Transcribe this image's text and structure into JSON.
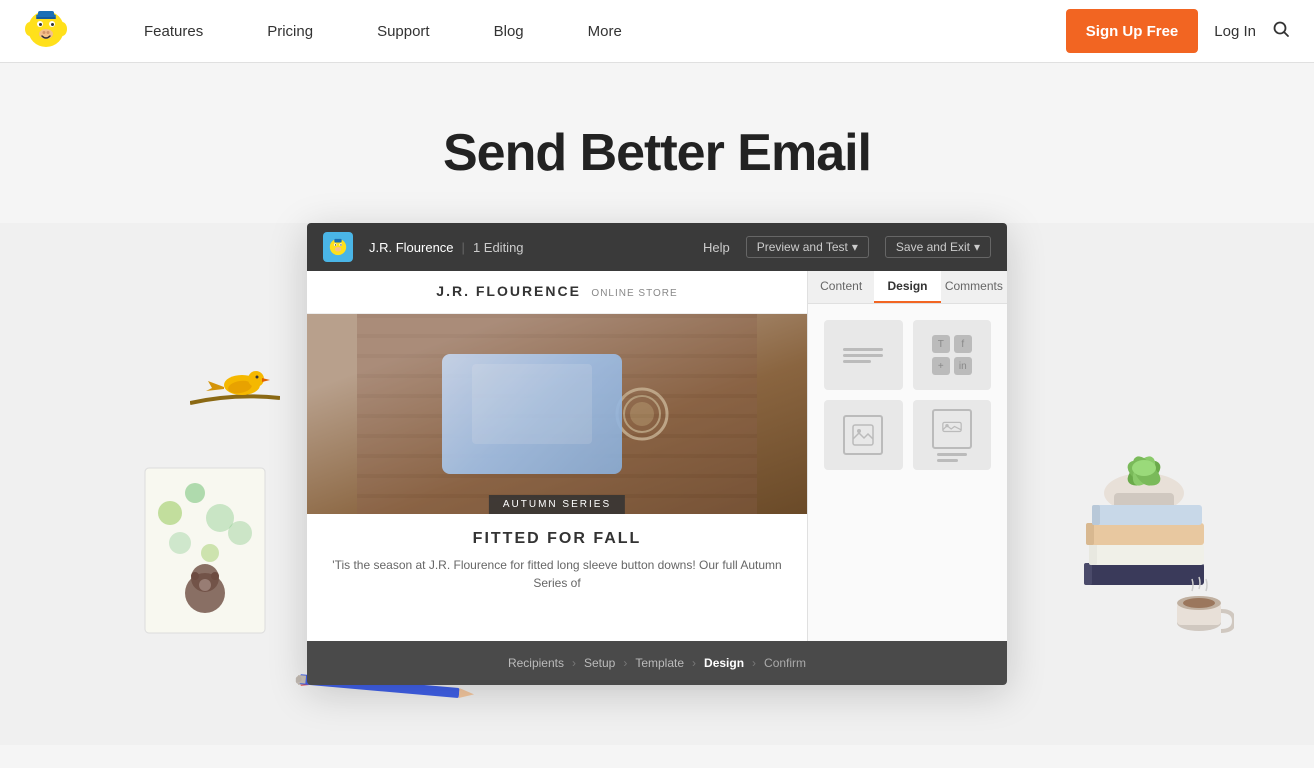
{
  "navbar": {
    "logo_alt": "Mailchimp",
    "links": [
      {
        "id": "features",
        "label": "Features"
      },
      {
        "id": "pricing",
        "label": "Pricing"
      },
      {
        "id": "support",
        "label": "Support"
      },
      {
        "id": "blog",
        "label": "Blog"
      },
      {
        "id": "more",
        "label": "More"
      }
    ],
    "signup_label": "Sign Up Free",
    "login_label": "Log In",
    "search_icon": "🔍"
  },
  "hero": {
    "title": "Send Better Email"
  },
  "app": {
    "topbar": {
      "user": "J.R. Flourence",
      "separator": "|",
      "editing": "1 Editing",
      "help": "Help",
      "preview_test": "Preview and Test",
      "save_exit": "Save and Exit",
      "dropdown_arrow": "▾"
    },
    "email_preview": {
      "store_name": "J.R. Flourence",
      "store_sub": "Online Store",
      "hero_banner": "Autumn Series",
      "title": "Fitted for Fall",
      "body_text": "'Tis the season at J.R. Flourence for fitted long sleeve button downs! Our full Autumn Series of"
    },
    "design_panel": {
      "tabs": [
        {
          "id": "content",
          "label": "Content",
          "active": false
        },
        {
          "id": "design",
          "label": "Design",
          "active": true
        },
        {
          "id": "comments",
          "label": "Comments",
          "active": false
        }
      ],
      "blocks": [
        {
          "id": "text-block",
          "type": "text"
        },
        {
          "id": "social-block",
          "type": "social"
        },
        {
          "id": "image-block-1",
          "type": "image"
        },
        {
          "id": "image-text-block",
          "type": "image-text"
        }
      ]
    }
  },
  "workflow": {
    "steps": [
      {
        "id": "recipients",
        "label": "Recipients",
        "state": "completed"
      },
      {
        "id": "setup",
        "label": "Setup",
        "state": "completed"
      },
      {
        "id": "template",
        "label": "Template",
        "state": "completed"
      },
      {
        "id": "design",
        "label": "Design",
        "state": "active"
      },
      {
        "id": "confirm",
        "label": "Confirm",
        "state": "upcoming"
      }
    ]
  }
}
